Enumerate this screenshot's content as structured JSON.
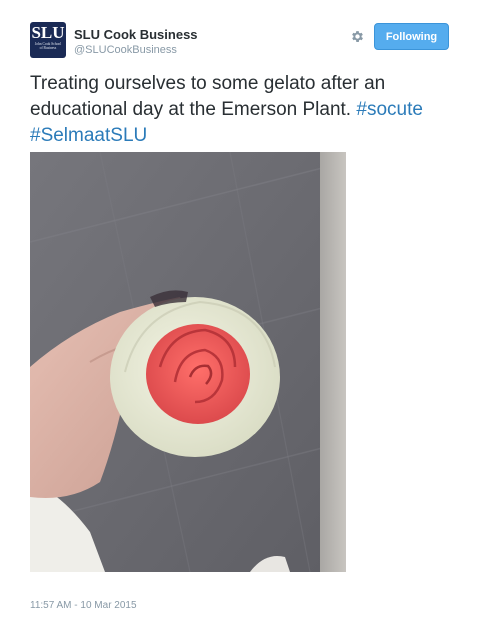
{
  "tweet": {
    "author_name": "SLU Cook Business",
    "author_handle": "@SLUCookBusiness",
    "avatar": {
      "logo_text": "SLU",
      "logo_subtext": "John Cook School of Business"
    },
    "follow_button_label": "Following",
    "settings_icon": "gear-icon",
    "text": {
      "line": "Treating ourselves to some gelato after an educational day at the Emerson Plant.",
      "hashtags": [
        "#socute",
        "#SelmaatSLU"
      ]
    },
    "photo": {
      "subject": "hand-holding-rose-shaped-gelato-cone"
    },
    "timestamp": "11:57 AM - 10 Mar 2015"
  },
  "colors": {
    "link": "#2b7bb9",
    "button": "#55acee",
    "muted": "#8899a6",
    "avatar_bg": "#1a2a55"
  }
}
